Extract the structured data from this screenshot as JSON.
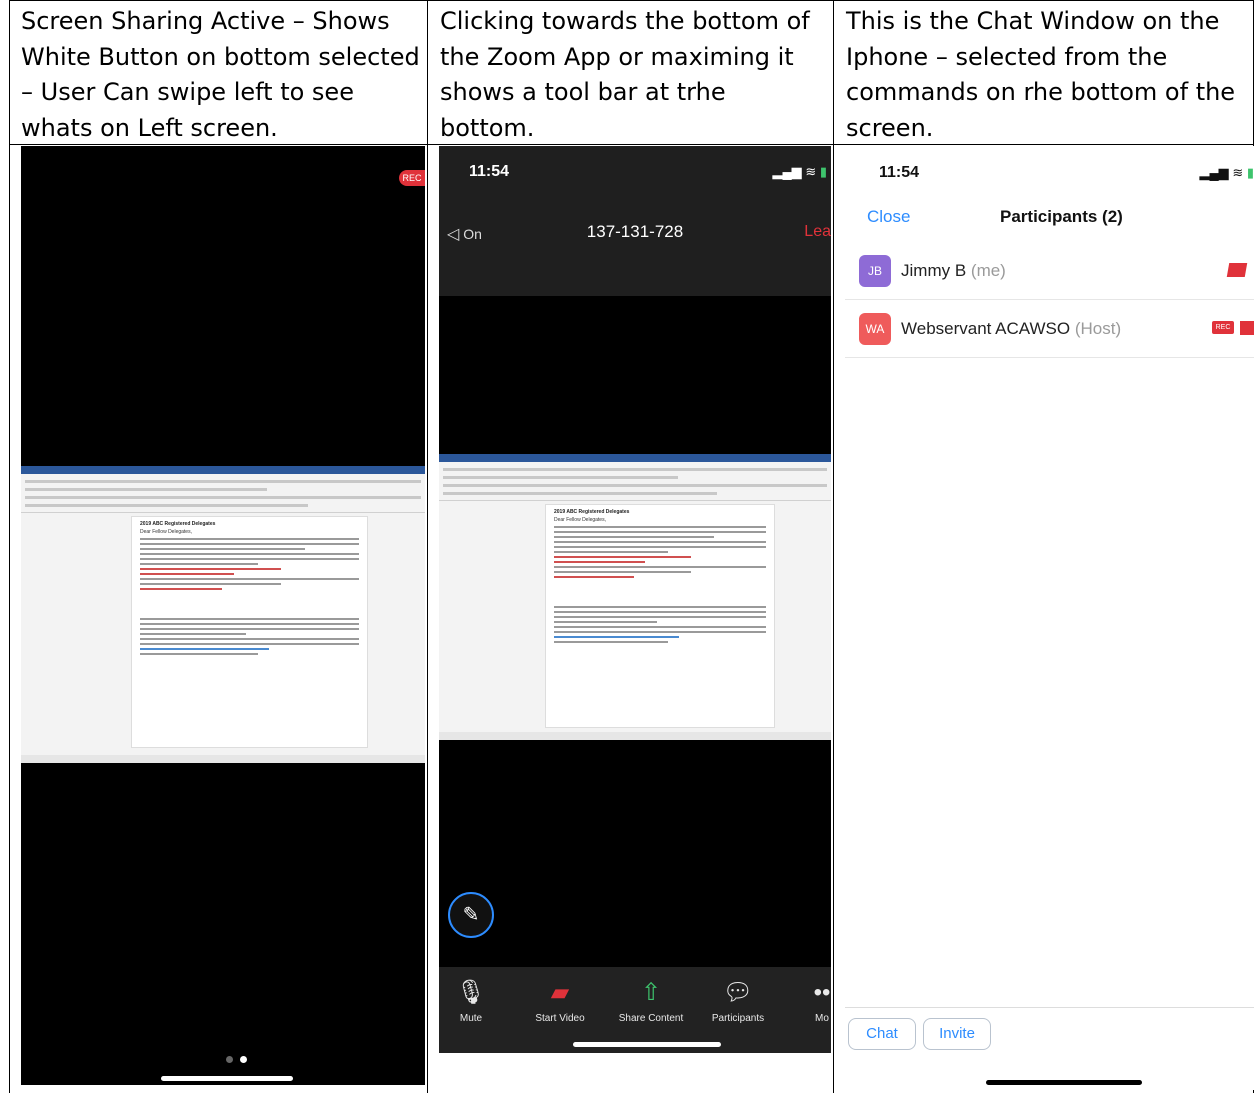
{
  "captions": [
    "Screen Sharing Active – Shows White Button on bottom selected – User Can swipe left to see whats on Left screen.",
    "Clicking towards the bottom of the Zoom App or maximing it shows a tool bar at trhe bottom.",
    "This is the Chat Window on the Iphone – selected from the commands on rhe bottom of the screen."
  ],
  "panel1": {
    "rec_badge": "REC",
    "document_title": "2019 ABC Registered Delegates",
    "greeting": "Dear Fellow Delegates,"
  },
  "panel2": {
    "time": "11:54",
    "audio_label": "On",
    "meeting_id": "137-131-728",
    "leave_label": "Lea",
    "toolbar": [
      {
        "label": "Mute",
        "icon": "microphone-icon"
      },
      {
        "label": "Start Video",
        "icon": "video-off-icon"
      },
      {
        "label": "Share Content",
        "icon": "share-icon"
      },
      {
        "label": "Participants",
        "icon": "chat-bubble-icon"
      },
      {
        "label": "Mo",
        "icon": "more-icon"
      }
    ],
    "colors": {
      "share_green": "#3ec46d",
      "video_red": "#e0323a",
      "leave_red": "#e0323a"
    }
  },
  "panel3": {
    "time": "11:54",
    "close_label": "Close",
    "title": "Participants (2)",
    "participants": [
      {
        "initials": "JB",
        "name": "Jimmy B",
        "tag": "(me)",
        "avatar_color": "#8e6bd6"
      },
      {
        "initials": "WA",
        "name": "Webservant ACAWSO",
        "tag": "(Host)",
        "avatar_color": "#ef5b5b"
      }
    ],
    "rec_badge": "REC",
    "chat_label": "Chat",
    "invite_label": "Invite",
    "accent": "#2d8cff"
  }
}
